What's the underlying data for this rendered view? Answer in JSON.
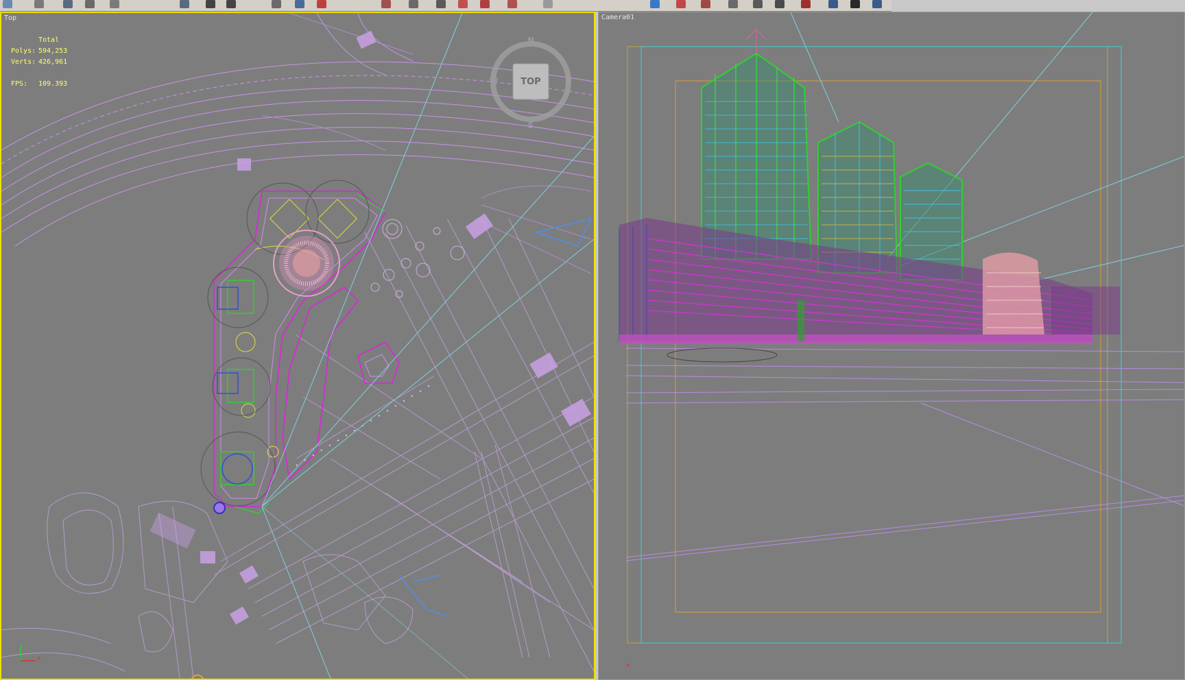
{
  "viewports": {
    "top": {
      "label": "Top",
      "stats": {
        "header": "Total",
        "polys_label": "Polys:",
        "polys_value": "594,253",
        "verts_label": "Verts:",
        "verts_value": "426,961",
        "fps_label": "FPS:",
        "fps_value": "109.393"
      },
      "viewcube": {
        "face": "TOP",
        "n": "N",
        "s": "S",
        "e": "E",
        "w": "W"
      },
      "axis": {
        "x": "x",
        "y": "y",
        "z": "z"
      }
    },
    "camera": {
      "label": "Camera01",
      "axis_x": "x"
    }
  },
  "colors": {
    "viewport_bg": "#7d7d7d",
    "active_border": "#f0e000",
    "stats_text": "#ffff70",
    "wire_violet": "#d48cf0",
    "wire_magenta": "#e020e0",
    "wire_green": "#30d030",
    "safe_frame_cyan": "#40d0d0",
    "safe_frame_orange": "#e0a030"
  },
  "icons": [
    "viewcube-icon",
    "axis-tripod-icon",
    "toolbar-tool-icons"
  ]
}
